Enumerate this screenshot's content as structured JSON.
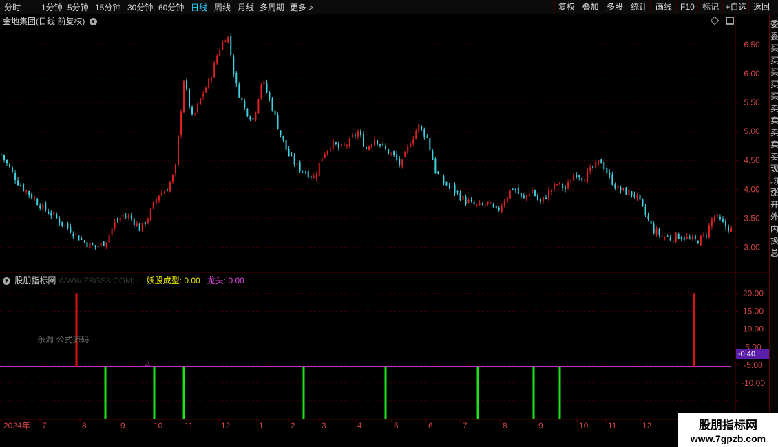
{
  "toolbar": {
    "periods": [
      {
        "label": "分时",
        "active": false
      },
      {
        "label": "1分钟",
        "active": false
      },
      {
        "label": "5分钟",
        "active": false
      },
      {
        "label": "15分钟",
        "active": false
      },
      {
        "label": "30分钟",
        "active": false
      },
      {
        "label": "60分钟",
        "active": false
      },
      {
        "label": "日线",
        "active": true
      },
      {
        "label": "周线",
        "active": false
      },
      {
        "label": "月线",
        "active": false
      },
      {
        "label": "多周期",
        "active": false
      },
      {
        "label": "更多 >",
        "active": false
      }
    ],
    "actions": [
      "复权",
      "叠加",
      "多股",
      "统计",
      "画线",
      "F10",
      "标记",
      "+自选",
      "返回"
    ]
  },
  "main_chart": {
    "title": "金地集团(日线 前复权)",
    "y_ticks": [
      "6.50",
      "6.00",
      "5.50",
      "5.00",
      "4.50",
      "4.00",
      "3.50",
      "3.00"
    ]
  },
  "indicator": {
    "name": "股朋指标网",
    "watermark": "WWW.ZBGS3.COM",
    "series1_name": "妖股成型:",
    "series1_value": "0.00",
    "series2_name": "龙头:",
    "series2_value": "0.00",
    "y_ticks": [
      "20.00",
      "15.00",
      "10.00",
      "5.00",
      "-5.00",
      "-10.00"
    ],
    "current_value": "-0.40",
    "annotation": "乐淘 公式源码"
  },
  "x_axis": {
    "labels": [
      "2024年",
      "7",
      "8",
      "9",
      "10",
      "11",
      "12",
      "1",
      "2",
      "3",
      "4",
      "5",
      "6",
      "7",
      "8",
      "9",
      "10",
      "11",
      "12"
    ]
  },
  "side_panel": {
    "chars": [
      "委",
      "委",
      "买",
      "买",
      "买",
      "买",
      "买",
      "卖",
      "卖",
      "卖",
      "卖",
      "卖",
      "现",
      "均",
      "涨",
      "开",
      "外",
      "内",
      "换",
      "总"
    ]
  },
  "logo": {
    "line1": "股朋指标网",
    "line2": "www.7gpzb.com"
  },
  "colors": {
    "up": "#e02020",
    "down": "#3fd0e0",
    "signal_up": "#e01010",
    "signal_down": "#20e020",
    "baseline": "#d040e0",
    "grid": "#5a0000",
    "active_tab": "#2fd3ff"
  },
  "chart_data": [
    {
      "type": "candlestick",
      "title": "金地集团(日线 前复权)",
      "ylim": [
        2.85,
        6.75
      ],
      "y_ticks": [
        3.0,
        3.5,
        4.0,
        4.5,
        5.0,
        5.5,
        6.0,
        6.5
      ],
      "x_labels": [
        "2024年",
        "7",
        "8",
        "9",
        "10",
        "11",
        "12",
        "1",
        "2",
        "3",
        "4",
        "5",
        "6",
        "7",
        "8",
        "9",
        "10",
        "11",
        "12"
      ],
      "close_path_by_month": [
        {
          "month": "2024-06",
          "values": [
            4.6,
            4.35,
            4.1,
            3.95,
            3.8
          ]
        },
        {
          "month": "2024-07",
          "values": [
            3.65,
            3.55,
            3.4,
            3.3,
            3.15
          ]
        },
        {
          "month": "2024-08",
          "values": [
            3.05,
            3.0,
            3.1,
            3.4,
            3.55
          ]
        },
        {
          "month": "2024-09",
          "values": [
            3.5,
            3.3,
            3.55,
            3.9,
            4.0
          ]
        },
        {
          "month": "2024-10",
          "values": [
            4.3,
            5.9,
            5.2,
            5.6,
            5.9
          ]
        },
        {
          "month": "2024-11",
          "values": [
            6.4,
            6.7,
            5.8,
            5.4,
            5.2
          ]
        },
        {
          "month": "2024-12",
          "values": [
            5.9,
            5.5,
            5.0,
            4.6,
            4.4
          ]
        },
        {
          "month": "2025-01",
          "values": [
            4.3,
            4.2,
            4.6,
            4.8,
            4.7
          ]
        },
        {
          "month": "2025-02",
          "values": [
            4.8,
            5.0,
            4.7,
            4.9,
            4.7
          ]
        },
        {
          "month": "2025-03",
          "values": [
            4.6,
            4.4,
            4.8,
            5.1,
            4.9
          ]
        },
        {
          "month": "2025-04",
          "values": [
            4.3,
            4.1,
            4.0,
            3.85,
            3.75
          ]
        },
        {
          "month": "2025-05",
          "values": [
            3.7,
            3.75,
            3.6,
            3.85,
            4.05
          ]
        },
        {
          "month": "2025-06",
          "values": [
            3.8,
            4.0,
            3.75,
            3.95,
            4.1
          ]
        },
        {
          "month": "2025-07",
          "values": [
            4.0,
            4.3,
            4.2,
            4.35,
            4.5
          ]
        },
        {
          "month": "2025-08",
          "values": [
            4.2,
            4.0,
            3.95,
            3.9,
            3.6
          ]
        },
        {
          "month": "2025-09",
          "values": [
            3.3,
            3.2,
            3.15,
            3.2,
            3.15
          ]
        },
        {
          "month": "2025-10",
          "values": [
            3.1,
            3.2,
            3.55,
            3.4,
            3.3
          ]
        }
      ]
    },
    {
      "type": "bar",
      "title": "股朋指标网",
      "ylim": [
        -15,
        22
      ],
      "y_ticks": [
        -10,
        -5,
        0,
        5,
        10,
        15,
        20
      ],
      "series": [
        {
          "name": "妖股成型",
          "color": "red",
          "x_labels_near": [
            "8",
            "12"
          ],
          "values": [
            20,
            20
          ]
        },
        {
          "name": "龙头",
          "color": "green",
          "x_labels_near": [
            "8-9",
            "10",
            "11",
            "2-3",
            "4-5",
            "7",
            "8-9",
            "9-10"
          ],
          "values": [
            -15,
            -15,
            -15,
            -15,
            -15,
            -15,
            -15,
            -15
          ]
        }
      ],
      "baseline": -0.4
    }
  ]
}
